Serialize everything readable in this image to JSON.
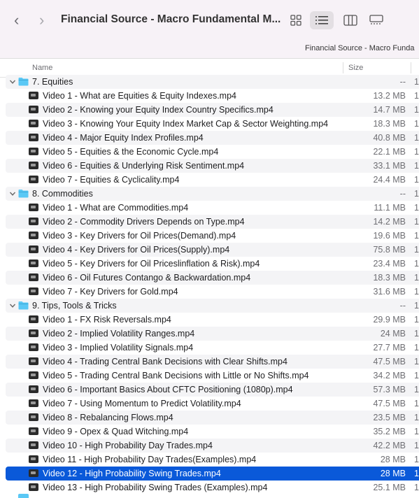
{
  "window": {
    "title": "Financial Source - Macro Fundamental M...",
    "path": "Financial Source - Macro Funda",
    "back_glyph": "‹",
    "forward_glyph": "›"
  },
  "columns": {
    "name": "Name",
    "size": "Size"
  },
  "rows": [
    {
      "type": "folder",
      "name": "7. Equities",
      "size": "--"
    },
    {
      "type": "file",
      "name": "Video 1 - What are Equities & Equity Indexes.mp4",
      "size": "13.2 MB"
    },
    {
      "type": "file",
      "name": "Video 2 - Knowing your Equity Index Country Specifics.mp4",
      "size": "14.7 MB"
    },
    {
      "type": "file",
      "name": "Video 3 - Knowing Your Equity Index Market Cap & Sector Weighting.mp4",
      "size": "18.3 MB"
    },
    {
      "type": "file",
      "name": "Video 4 - Major Equity Index Profiles.mp4",
      "size": "40.8 MB"
    },
    {
      "type": "file",
      "name": "Video 5 - Equities & the Economic Cycle.mp4",
      "size": "22.1 MB"
    },
    {
      "type": "file",
      "name": "Video 6 - Equities & Underlying Risk Sentiment.mp4",
      "size": "33.1 MB"
    },
    {
      "type": "file",
      "name": "Video 7 - Equities & Cyclicality.mp4",
      "size": "24.4 MB"
    },
    {
      "type": "folder",
      "name": "8. Commodities",
      "size": "--"
    },
    {
      "type": "file",
      "name": "Video 1 - What are Commodities.mp4",
      "size": "11.1 MB"
    },
    {
      "type": "file",
      "name": "Video 2 - Commodity Drivers Depends on Type.mp4",
      "size": "14.2 MB"
    },
    {
      "type": "file",
      "name": "Video 3 - Key Drivers for Oil Prices(Demand).mp4",
      "size": "19.6 MB"
    },
    {
      "type": "file",
      "name": "Video 4 - Key Drivers for Oil Prices(Supply).mp4",
      "size": "75.8 MB"
    },
    {
      "type": "file",
      "name": "Video 5 - Key Drivers for Oil Priceslinflation & Risk).mp4",
      "size": "23.4 MB"
    },
    {
      "type": "file",
      "name": "Video 6 - Oil Futures Contango & Backwardation.mp4",
      "size": "18.3 MB"
    },
    {
      "type": "file",
      "name": "Video 7 - Key Drivers for Gold.mp4",
      "size": "31.6 MB"
    },
    {
      "type": "folder",
      "name": "9. Tips, Tools & Tricks",
      "size": "--"
    },
    {
      "type": "file",
      "name": "Video 1 - FX Risk Reversals.mp4",
      "size": "29.9 MB"
    },
    {
      "type": "file",
      "name": "Video 2 - Implied Volatility Ranges.mp4",
      "size": "24 MB"
    },
    {
      "type": "file",
      "name": "Video 3 - Implied Volatility Signals.mp4",
      "size": "27.7 MB"
    },
    {
      "type": "file",
      "name": "Video 4 - Trading Central Bank Decisions with Clear Shifts.mp4",
      "size": "47.5 MB"
    },
    {
      "type": "file",
      "name": "Video 5 - Trading Central Bank Decisions with Little or No Shifts.mp4",
      "size": "34.2 MB"
    },
    {
      "type": "file",
      "name": "Video 6 - Important Basics About CFTC Positioning (1080p).mp4",
      "size": "57.3 MB"
    },
    {
      "type": "file",
      "name": "Video 7 - Using Momentum to Predict Volatility.mp4",
      "size": "47.5 MB"
    },
    {
      "type": "file",
      "name": "Video 8 - Rebalancing Flows.mp4",
      "size": "23.5 MB"
    },
    {
      "type": "file",
      "name": "Video 9 - Opex & Quad Witching.mp4",
      "size": "35.2 MB"
    },
    {
      "type": "file",
      "name": "Video 10 - High Probability Day Trades.mp4",
      "size": "42.2 MB"
    },
    {
      "type": "file",
      "name": "Video 11 - High Probability Day Trades(Examples).mp4",
      "size": "28 MB"
    },
    {
      "type": "file",
      "name": "Video 12 - High Probability Swing Trades.mp4",
      "size": "28 MB",
      "selected": true
    },
    {
      "type": "file",
      "name": "Video 13 - High Probability Swing Trades (Examples).mp4",
      "size": "25.1 MB"
    }
  ],
  "kind_cutoff_glyph": "1",
  "colors": {
    "selection": "#0a59d9",
    "folder": "#5ac8f5",
    "toolbar": "#f7f2f7"
  }
}
